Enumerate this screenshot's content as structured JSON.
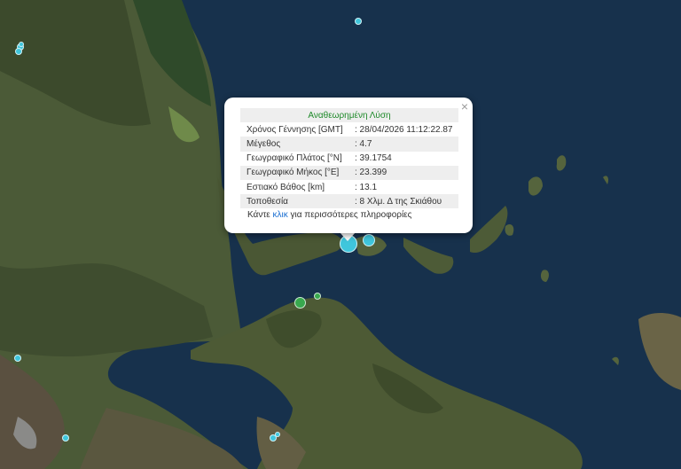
{
  "popup": {
    "header": "Αναθεωρημένη Λύση",
    "close_label": "×",
    "rows": [
      {
        "label": "Χρόνος Γέννησης [GMT]",
        "value": ": 28/04/2026 11:12:22.87"
      },
      {
        "label": "Μέγεθος",
        "value": ": 4.7"
      },
      {
        "label": "Γεωγραφικό Πλάτος [°N]",
        "value": ": 39.1754"
      },
      {
        "label": "Γεωγραφικό Μήκος [°E]",
        "value": ": 23.399"
      },
      {
        "label": "Εστιακό Βάθος [km]",
        "value": ": 13.1"
      },
      {
        "label": "Τοποθεσία",
        "value": ": 8 Χλμ. Δ της Σκιάθου"
      }
    ],
    "more_prefix": "Κάντε ",
    "more_link": "κλικ",
    "more_suffix": " για περισσότερες πληροφορίες"
  },
  "colors": {
    "sea": "#17314c",
    "marker_cyan": "#3fc6dc",
    "marker_green": "#39a84e",
    "header_green": "#1f8a2a",
    "link_blue": "#1b6fd1"
  },
  "markers": [
    {
      "name": "earthquake-marker-selected",
      "color": "cyan"
    },
    {
      "name": "earthquake-marker-skiathos",
      "color": "cyan"
    },
    {
      "name": "earthquake-marker-north-sea",
      "color": "cyan"
    },
    {
      "name": "earthquake-marker-west-1",
      "color": "cyan"
    },
    {
      "name": "earthquake-marker-west-2",
      "color": "cyan"
    },
    {
      "name": "earthquake-marker-west-3",
      "color": "cyan"
    },
    {
      "name": "earthquake-marker-evia-north",
      "color": "green"
    },
    {
      "name": "earthquake-marker-evia-north-2",
      "color": "green"
    },
    {
      "name": "earthquake-marker-sw",
      "color": "cyan"
    },
    {
      "name": "earthquake-marker-south-1",
      "color": "cyan"
    },
    {
      "name": "earthquake-marker-south-2",
      "color": "cyan"
    },
    {
      "name": "earthquake-marker-south-3",
      "color": "cyan"
    }
  ]
}
